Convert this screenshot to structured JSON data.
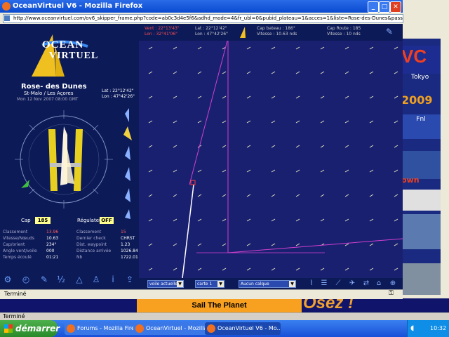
{
  "popup": {
    "title": "OceanVirtuel V6 - Mozilla Firefox",
    "url": "http://www.oceanvirtuel.com/ov6_skipper_frame.php?code=ab0c3d4e5f6&adhd_mode=4&fr_ubl=0&pubid_plateau=1&acces=1&liste=Rose-des-Dunes&pass=...",
    "status": "Terminé",
    "close_symbol": "✕",
    "max_symbol": "□",
    "min_symbol": "_"
  },
  "panel": {
    "logo_line1": "OCEAN",
    "logo_line2": "VIRTUEL",
    "boat_name": "Rose- des Dunes",
    "route": "St-Malo / Les Açores",
    "date": "Mon 12 Nov 2007 08:00 GMT",
    "lat": "Lat : 22°12'42\"",
    "lon": "Lon : 47°42'26\"",
    "cap_label": "Cap",
    "cap_value": "185",
    "regulateur_label": "Régulateur",
    "regulateur_value": "OFF",
    "stats": [
      {
        "l1": "Classement",
        "v1": "13.96",
        "l2": "Classement",
        "v2": "15"
      },
      {
        "l1": "Vitesse/Nœuds",
        "v1": "10.63",
        "l2": "Dernier check",
        "v2": "CHRST"
      },
      {
        "l1": "Cap/orient",
        "v1": "234°",
        "l2": "Dist. waypoint",
        "v2": "1.23"
      },
      {
        "l1": "Angle vent/voile",
        "v1": "000",
        "l2": "Distance arrivée",
        "v2": "1026.84"
      },
      {
        "l1": "Temps écoulé",
        "v1": "01:21",
        "l2": "Nb",
        "v2": "1722.01"
      }
    ]
  },
  "header": {
    "c1_line1": "Vent : 22°13'43\"",
    "c1_line2": "Lon : 32°41'06\"",
    "c2_line1": "Lat : 22°12'42\"",
    "c2_line2": "Lon : 47°42'26\"",
    "c3_line1": "Cap bateau : 186°",
    "c3_line2": "Vitesse : 10.63 nds",
    "c4_line1": "Cap Route : 185",
    "c4_line2": "Vitesse : 10 nds",
    "cap_highlight": "186°",
    "route_highlight": "185"
  },
  "toolbar": {
    "select1": "voile actuelle",
    "select2": "carte 1",
    "select3": "Aucun calque"
  },
  "background": {
    "sail": "Sail The Planet",
    "vendez": "Osez !",
    "status": "Terminé",
    "ads": [
      "VC",
      "Tokyo",
      "2009",
      "Fnl",
      "own"
    ]
  },
  "taskbar": {
    "start": "démarrer",
    "tasks": [
      "Forums - Mozilla Firefox",
      "OceanVirtuel - Mozilla...",
      "OceanVirtuel V6 - Mo..."
    ],
    "clock": "10:32"
  },
  "colors": {
    "panel_bg": "#0c1a58",
    "map_bg": "#1a2070",
    "route_magenta": "#d040d0",
    "track_white": "#ffffff",
    "accent_yellow": "#ffff90"
  }
}
